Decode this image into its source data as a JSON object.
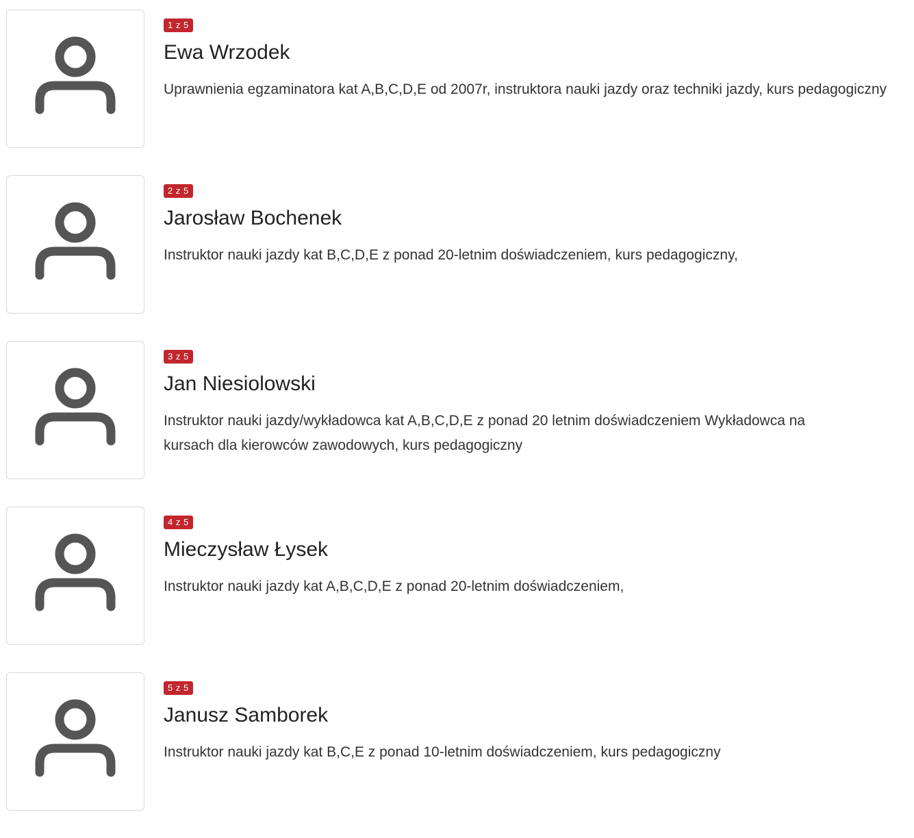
{
  "instructors": [
    {
      "counter": "1 z 5",
      "name": "Ewa Wrzodek",
      "description": "Uprawnienia egzaminatora kat A,B,C,D,E od 2007r, instruktora nauki jazdy oraz techniki jazdy, kurs pedagogiczny",
      "avatar_icon": "user-icon"
    },
    {
      "counter": "2 z 5",
      "name": "Jarosław Bochenek",
      "description": "Instruktor nauki jazdy kat B,C,D,E z ponad 20-letnim doświadczeniem, kurs pedagogiczny,",
      "avatar_icon": "user-icon"
    },
    {
      "counter": "3 z 5",
      "name": "Jan Niesiolowski",
      "description": "Instruktor nauki jazdy/wykładowca kat A,B,C,D,E z ponad 20 letnim doświadczeniem Wykładowca na kursach dla kierowców zawodowych, kurs pedagogiczny",
      "avatar_icon": "user-icon"
    },
    {
      "counter": "4 z 5",
      "name": "Mieczysław Łysek",
      "description": "Instruktor nauki jazdy kat A,B,C,D,E z ponad 20-letnim doświadczeniem,",
      "avatar_icon": "user-icon"
    },
    {
      "counter": "5 z 5",
      "name": "Janusz Samborek",
      "description": "Instruktor nauki jazdy kat B,C,E z ponad 10-letnim doświadczeniem, kurs pedagogiczny",
      "avatar_icon": "user-icon"
    }
  ],
  "colors": {
    "badge_background": "#c1272d",
    "icon": "#555555",
    "border": "#d9d9d9"
  }
}
